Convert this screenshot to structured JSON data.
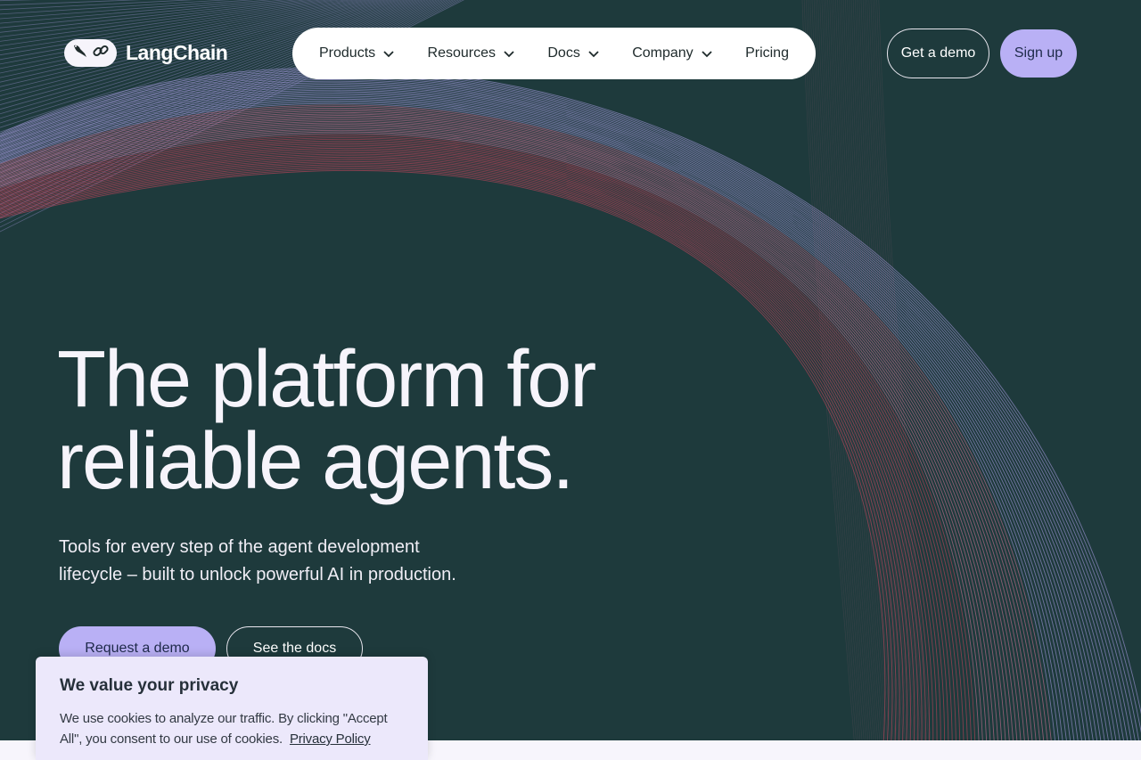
{
  "brand": {
    "name": "LangChain",
    "logo_icons": [
      "bird-icon",
      "chain-link-icon"
    ]
  },
  "nav": {
    "items": [
      {
        "label": "Products",
        "dropdown": true
      },
      {
        "label": "Resources",
        "dropdown": true
      },
      {
        "label": "Docs",
        "dropdown": true
      },
      {
        "label": "Company",
        "dropdown": true
      },
      {
        "label": "Pricing",
        "dropdown": false
      }
    ]
  },
  "header_actions": {
    "demo_label": "Get a demo",
    "signup_label": "Sign up"
  },
  "hero": {
    "title_line1": "The platform for",
    "title_line2": "reliable agents.",
    "subtitle_line1": "Tools for every step of the agent development",
    "subtitle_line2": "lifecycle – built to unlock powerful AI in production.",
    "primary_cta": "Request a demo",
    "secondary_cta": "See the docs"
  },
  "cookie_banner": {
    "title": "We value your privacy",
    "text": "We use cookies to analyze our traffic. By clicking \"Accept All\", you consent to our use of cookies.",
    "link": "Privacy Policy"
  },
  "colors": {
    "background": "#1e3a3c",
    "accent": "#b9b0f5",
    "line_violet": "#b7a6f2",
    "line_pink": "#e37aa0",
    "line_red": "#d9455e"
  }
}
